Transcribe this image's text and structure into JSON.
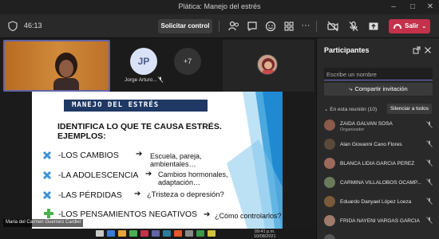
{
  "window": {
    "title": "Plática: Manejo del estrés"
  },
  "toolbar": {
    "timer": "46:13",
    "request_control": "Solicitar control",
    "leave": "Salir"
  },
  "stage": {
    "jp_initials": "JP",
    "jp_name": "Jorge Arturo...",
    "overflow_count": "+7",
    "presenter_name": "Maria del Carmen Guerrero Cardiel"
  },
  "slide": {
    "title": "MANEJO DEL ESTRÉS",
    "heading_1": "IDENTIFICA LO QUE TE CAUSA ESTRÉS.",
    "heading_2": "EJEMPLOS:",
    "rows": [
      {
        "label": "-LOS CAMBIOS",
        "desc_1": "Escuela, pareja,",
        "desc_2": "ambientales…"
      },
      {
        "label": "-LA ADOLESCENCIA",
        "desc_1": "Cambios hormonales,",
        "desc_2": "adaptación…"
      },
      {
        "label": "-LAS PÉRDIDAS",
        "desc_1": "¿Tristeza o depresión?",
        "desc_2": ""
      },
      {
        "label": "-LOS PENSAMIENTOS NEGATIVOS",
        "desc_1": "¿Cómo controlarlos?",
        "desc_2": ""
      }
    ]
  },
  "taskbar": {
    "time": "09:41 p.m.",
    "date": "10/08/2021"
  },
  "panel": {
    "title": "Participantes",
    "search_placeholder": "Escribe un nombre",
    "share_invite": "Compartir invitación",
    "in_meeting": "En esta reunión (10)",
    "mute_all": "Silenciar a todos",
    "participants": [
      {
        "name": "ZAIDA GALVAN SOSA",
        "role": "Organizador",
        "color": "#8a5a4a"
      },
      {
        "name": "Alan Giovanni Cano Flores",
        "role": "",
        "color": "#5a4a3a"
      },
      {
        "name": "BLANCA LIDIA GARCIA PEREZ",
        "role": "",
        "color": "#9a6a5a"
      },
      {
        "name": "CARMINA VILLALOBOS OCAMP...",
        "role": "",
        "color": "#6a7a5a"
      },
      {
        "name": "Eduardo Danyael López Loeza",
        "role": "",
        "color": "#7a5a3a"
      },
      {
        "name": "FRIDA NAYENI VARGAS GARCIA",
        "role": "",
        "color": "#a07a6a"
      },
      {
        "name": "",
        "role": "",
        "color": "#555555"
      }
    ]
  }
}
